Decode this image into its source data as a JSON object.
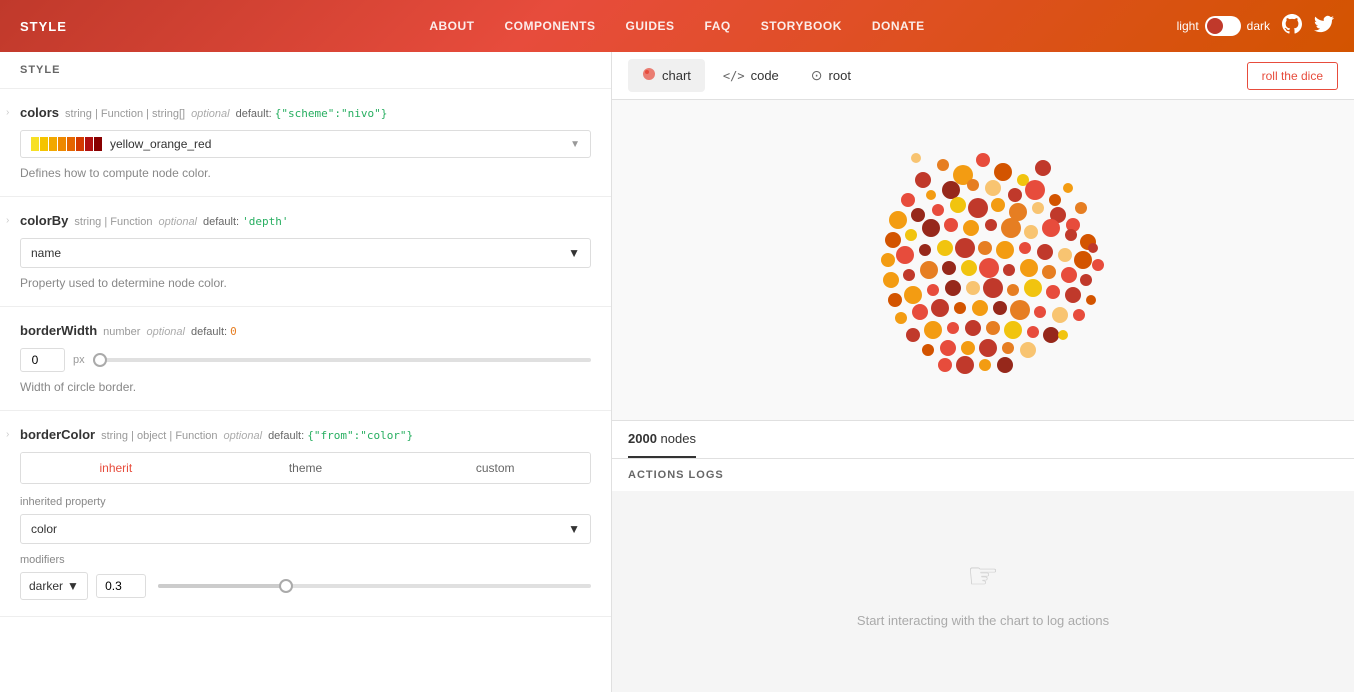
{
  "header": {
    "style_label": "STYLE",
    "nav": [
      {
        "id": "about",
        "label": "ABOUT"
      },
      {
        "id": "components",
        "label": "COMPONENTS"
      },
      {
        "id": "guides",
        "label": "GUIDES"
      },
      {
        "id": "faq",
        "label": "FAQ"
      },
      {
        "id": "storybook",
        "label": "STORYBOOK"
      },
      {
        "id": "donate",
        "label": "DONATE"
      }
    ],
    "theme_light": "light",
    "theme_dark": "dark",
    "roll_dice": "roll the dice"
  },
  "tabs": [
    {
      "id": "chart",
      "label": "chart",
      "icon": "🔴"
    },
    {
      "id": "code",
      "label": "code",
      "icon": "</>"
    },
    {
      "id": "root",
      "label": "root",
      "icon": "⊙"
    }
  ],
  "props": {
    "colors": {
      "name": "colors",
      "type": "string | Function | string[]",
      "optional": "optional",
      "default_label": "default:",
      "default_value": "{\"scheme\":\"nivo\"}",
      "selected": "yellow_orange_red",
      "description": "Defines how to compute node color."
    },
    "colorBy": {
      "name": "colorBy",
      "type": "string | Function",
      "optional": "optional",
      "default_label": "default:",
      "default_value": "'depth'",
      "selected": "name",
      "description": "Property used to determine node color."
    },
    "borderWidth": {
      "name": "borderWidth",
      "type": "number",
      "optional": "optional",
      "default_label": "default:",
      "default_value": "0",
      "value": "0",
      "unit": "px",
      "slider_pct": 0,
      "description": "Width of circle border."
    },
    "borderColor": {
      "name": "borderColor",
      "type": "string | object | Function",
      "optional": "optional",
      "default_label": "default:",
      "default_value": "{\"from\":\"color\"}",
      "active_tab": "inherit",
      "tabs": [
        "inherit",
        "theme",
        "custom"
      ],
      "inherited_property_label": "inherited property",
      "inherited_property_value": "color",
      "modifiers_label": "modifiers",
      "modifier_type": "darker",
      "modifier_value": "0.3",
      "modifier_slider_pct": 30
    }
  },
  "stats": {
    "count": "2000",
    "unit": "nodes"
  },
  "actions_log": {
    "label": "ACTIONS LOGS"
  },
  "empty_state": {
    "text": "Start interacting with the chart to log actions"
  },
  "colors": {
    "swatches": [
      "#f7e025",
      "#f5c400",
      "#f0a000",
      "#e87a00",
      "#de5a00",
      "#c43020",
      "#9b1020"
    ]
  }
}
